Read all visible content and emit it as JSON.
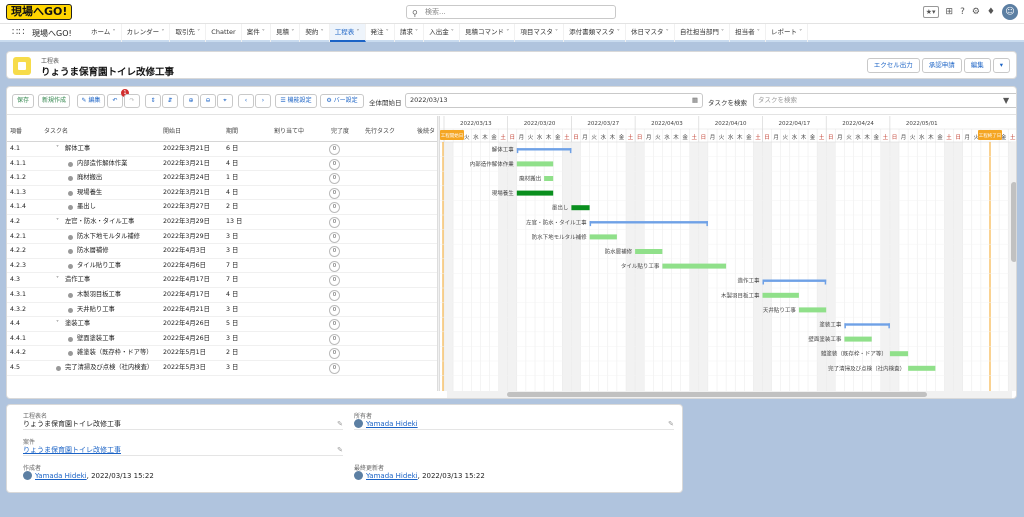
{
  "app": {
    "logo": "現場へGO!",
    "app_name": "現場へGO!",
    "search_placeholder": "検索..."
  },
  "nav_tabs": [
    "ホーム",
    "カレンダー",
    "取引先",
    "Chatter",
    "案件",
    "見積",
    "契約",
    "工程表",
    "発注",
    "請求",
    "入出金",
    "見積コマンド",
    "項目マスタ",
    "添付書類マスタ",
    "休日マスタ",
    "自社担当部門",
    "担当者",
    "レポート"
  ],
  "nav_active": 7,
  "record": {
    "object_label": "工程表",
    "title": "りょうま保育園トイレ改修工事",
    "buttons": [
      "エクセル出力",
      "承認申請",
      "編集"
    ]
  },
  "toolbar": {
    "save": "保存",
    "new": "新規作成",
    "edit": "編集",
    "badge": "1",
    "display_settings": "☰ 機能設定",
    "bar_settings": "⚙ バー設定",
    "start_date_label": "全体開始日",
    "start_date": "2022/03/13",
    "task_search_label": "タスクを検索",
    "task_search_placeholder": "タスクを検索"
  },
  "grid_headers": [
    "項番",
    "タスク名",
    "開始日",
    "期間",
    "割り当て中",
    "完了度",
    "先行タスク",
    "後続タ"
  ],
  "grid_rows": [
    {
      "no": "4.1",
      "name": "解体工事",
      "start": "2022年3月21日",
      "dur": "6 日",
      "pct": "0",
      "level": 1,
      "group": true
    },
    {
      "no": "4.1.1",
      "name": "内部造作解体作業",
      "start": "2022年3月21日",
      "dur": "4 日",
      "pct": "0",
      "level": 2,
      "group": false
    },
    {
      "no": "4.1.2",
      "name": "廃材搬出",
      "start": "2022年3月24日",
      "dur": "1 日",
      "pct": "0",
      "level": 2,
      "group": false
    },
    {
      "no": "4.1.3",
      "name": "現場養生",
      "start": "2022年3月21日",
      "dur": "4 日",
      "pct": "0",
      "level": 2,
      "group": false
    },
    {
      "no": "4.1.4",
      "name": "墨出し",
      "start": "2022年3月27日",
      "dur": "2 日",
      "pct": "0",
      "level": 2,
      "group": false
    },
    {
      "no": "4.2",
      "name": "左官・防水・タイル工事",
      "start": "2022年3月29日",
      "dur": "13 日",
      "pct": "0",
      "level": 1,
      "group": true
    },
    {
      "no": "4.2.1",
      "name": "防水下地モルタル補修",
      "start": "2022年3月29日",
      "dur": "3 日",
      "pct": "0",
      "level": 2,
      "group": false
    },
    {
      "no": "4.2.2",
      "name": "防水層補修",
      "start": "2022年4月3日",
      "dur": "3 日",
      "pct": "0",
      "level": 2,
      "group": false
    },
    {
      "no": "4.2.3",
      "name": "タイル貼り工事",
      "start": "2022年4月6日",
      "dur": "7 日",
      "pct": "0",
      "level": 2,
      "group": false
    },
    {
      "no": "4.3",
      "name": "造作工事",
      "start": "2022年4月17日",
      "dur": "7 日",
      "pct": "0",
      "level": 1,
      "group": true
    },
    {
      "no": "4.3.1",
      "name": "木製羽目板工事",
      "start": "2022年4月17日",
      "dur": "4 日",
      "pct": "0",
      "level": 2,
      "group": false
    },
    {
      "no": "4.3.2",
      "name": "天井貼り工事",
      "start": "2022年4月21日",
      "dur": "3 日",
      "pct": "0",
      "level": 2,
      "group": false
    },
    {
      "no": "4.4",
      "name": "塗装工事",
      "start": "2022年4月26日",
      "dur": "5 日",
      "pct": "0",
      "level": 1,
      "group": true
    },
    {
      "no": "4.4.1",
      "name": "壁面塗装工事",
      "start": "2022年4月26日",
      "dur": "3 日",
      "pct": "0",
      "level": 2,
      "group": false
    },
    {
      "no": "4.4.2",
      "name": "雑塗装（既存枠・ドア等）",
      "start": "2022年5月1日",
      "dur": "2 日",
      "pct": "0",
      "level": 2,
      "group": false
    },
    {
      "no": "4.5",
      "name": "完了清掃及び点検（社内検査）",
      "start": "2022年5月3日",
      "dur": "3 日",
      "pct": "0",
      "level": 1,
      "group": false
    }
  ],
  "gantt": {
    "weeks": [
      "2022/03/13",
      "2022/03/20",
      "2022/03/27",
      "2022/04/03",
      "2022/04/10",
      "2022/04/17",
      "2022/04/24",
      "2022/05/01"
    ],
    "weekday_names": [
      "日",
      "月",
      "火",
      "水",
      "木",
      "金",
      "土"
    ],
    "start_marker": "工程開始日",
    "end_marker": "工程終了日",
    "colors": {
      "group": "#6fa1e6",
      "task": "#90e08a",
      "critical": "#0a8f1e",
      "weekend": "#f2f2f2",
      "marker": "#f5a623"
    },
    "tasks": [
      {
        "label": "解体工事",
        "start": 8,
        "dur": 6,
        "type": "group"
      },
      {
        "label": "内部造作解体作業",
        "start": 8,
        "dur": 4,
        "type": "task"
      },
      {
        "label": "廃材搬出",
        "start": 11,
        "dur": 1,
        "type": "task"
      },
      {
        "label": "現場養生",
        "start": 8,
        "dur": 4,
        "type": "critical"
      },
      {
        "label": "墨出し",
        "start": 14,
        "dur": 2,
        "type": "critical"
      },
      {
        "label": "左官・防水・タイル工事",
        "start": 16,
        "dur": 13,
        "type": "group"
      },
      {
        "label": "防水下地モルタル補修",
        "start": 16,
        "dur": 3,
        "type": "task"
      },
      {
        "label": "防水層補修",
        "start": 21,
        "dur": 3,
        "type": "task"
      },
      {
        "label": "タイル貼り工事",
        "start": 24,
        "dur": 7,
        "type": "task"
      },
      {
        "label": "造作工事",
        "start": 35,
        "dur": 7,
        "type": "group"
      },
      {
        "label": "木製羽目板工事",
        "start": 35,
        "dur": 4,
        "type": "task"
      },
      {
        "label": "天井貼り工事",
        "start": 39,
        "dur": 3,
        "type": "task"
      },
      {
        "label": "塗装工事",
        "start": 44,
        "dur": 5,
        "type": "group"
      },
      {
        "label": "壁面塗装工事",
        "start": 44,
        "dur": 3,
        "type": "task"
      },
      {
        "label": "雑塗装（既存枠・ドア等）",
        "start": 49,
        "dur": 2,
        "type": "task"
      },
      {
        "label": "完了清掃及び点検（社内検査）",
        "start": 51,
        "dur": 3,
        "type": "task"
      }
    ]
  },
  "detail": {
    "f1_label": "工程表名",
    "f1_value": "りょうま保育園トイレ改修工事",
    "f2_label": "所有者",
    "f2_value": "Yamada Hideki",
    "f3_label": "案件",
    "f3_value": "りょうま保育園トイレ改修工事",
    "f4_label": "作成者",
    "f4_user": "Yamada Hideki",
    "f4_date": ", 2022/03/13 15:22",
    "f5_label": "最終更新者",
    "f5_user": "Yamada Hideki",
    "f5_date": ", 2022/03/13 15:22"
  }
}
